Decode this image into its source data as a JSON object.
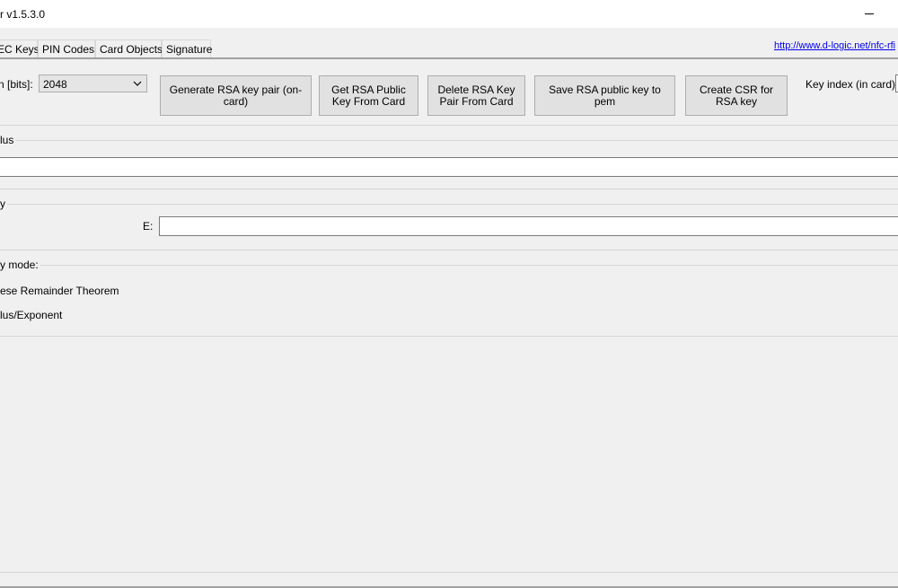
{
  "window": {
    "title": "r v1.5.3.0"
  },
  "tabs": [
    {
      "label": "EC Keys"
    },
    {
      "label": "PIN Codes"
    },
    {
      "label": "Card Objects"
    },
    {
      "label": "Signature"
    }
  ],
  "link": {
    "text": "http://www.d-logic.net/nfc-rfi"
  },
  "key_length": {
    "label": "n [bits]:",
    "value": "2048"
  },
  "buttons": {
    "generate": "Generate RSA key pair (on-card)",
    "get_public": "Get RSA Public Key From Card",
    "delete_pair": "Delete RSA Key Pair From Card",
    "save_pem": "Save RSA public key to pem",
    "create_csr": "Create CSR for RSA key"
  },
  "key_index": {
    "label": "Key index (in card):"
  },
  "modulus": {
    "title": "lus",
    "value": ""
  },
  "exponent_group": {
    "title": "y",
    "e_label": "E:",
    "e_value": ""
  },
  "mode": {
    "title": "y mode:",
    "options": [
      {
        "label": "ese Remainder Theorem"
      },
      {
        "label": "lus/Exponent"
      }
    ]
  }
}
